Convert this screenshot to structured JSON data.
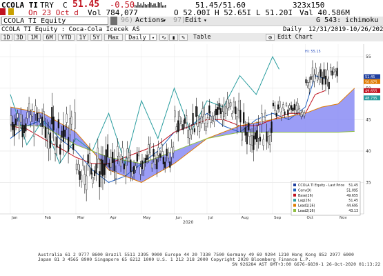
{
  "quote": {
    "ticker": "CCOLA TI",
    "currency": "TRY",
    "price_prefix": "C",
    "price": "51.45",
    "change": "-0.50",
    "bid_ask": "51.45/51.60",
    "size": "323x150",
    "date_label": "On 23 Oct d",
    "volume": "Vol 784,077",
    "open": "O 52.00I",
    "high": "H 52.65I",
    "low": "L 51.20I",
    "value": "Val 40.586M"
  },
  "command": {
    "security": "CCOLA TI Equity",
    "actions_num": "96)",
    "actions": "Actions",
    "edit_num": "97)",
    "edit": "Edit",
    "page": "G 543: ichimoku"
  },
  "title": {
    "name": "CCOLA TI Equity : Coca-Cola Icecek AS",
    "period": "Daily",
    "range": "12/31/2019-10/26/2020"
  },
  "toolbar": {
    "periods": [
      "1D",
      "3D",
      "1M",
      "6M",
      "YTD",
      "1Y",
      "5Y",
      "Max"
    ],
    "frequency": "Daily",
    "table": "Table",
    "edit_chart": "Edit Chart"
  },
  "chart_data": {
    "type": "line",
    "xlabel": "2020",
    "x_ticks": [
      "Jan",
      "Feb",
      "Mar",
      "Apr",
      "May",
      "Jun",
      "Jul",
      "Aug",
      "Sep",
      "Oct",
      "Nov"
    ],
    "y_ticks": [
      35,
      40,
      45,
      50,
      55
    ],
    "ylim": [
      30,
      57
    ],
    "y_label_side": "right",
    "grid": true,
    "annotation": "Hi: 55.15",
    "price_candles_monthly": [
      {
        "month": "Jan",
        "low": 40,
        "high": 50
      },
      {
        "month": "Feb",
        "low": 36,
        "high": 50
      },
      {
        "month": "Mar",
        "low": 31,
        "high": 44
      },
      {
        "month": "Apr",
        "low": 33,
        "high": 43
      },
      {
        "month": "May",
        "low": 35,
        "high": 43
      },
      {
        "month": "Jun",
        "low": 40,
        "high": 49
      },
      {
        "month": "Jul",
        "low": 42,
        "high": 51
      },
      {
        "month": "Aug",
        "low": 38,
        "high": 49
      },
      {
        "month": "Sep",
        "low": 44,
        "high": 49
      },
      {
        "month": "Oct",
        "low": 48,
        "high": 55.15
      }
    ],
    "series": [
      {
        "name": "Conv(9)",
        "x": [
          0,
          0.5,
          1,
          1.5,
          2,
          2.5,
          3,
          3.5,
          4,
          4.5,
          5,
          5.5,
          6,
          6.5,
          7,
          7.5,
          8,
          8.5,
          9,
          9.3,
          9.6
        ],
        "values": [
          42,
          44,
          45,
          42,
          40,
          37,
          35,
          36,
          38,
          40,
          43,
          44,
          46,
          44,
          43,
          45,
          46,
          45,
          47,
          52,
          51.5
        ]
      },
      {
        "name": "Base(26)",
        "x": [
          0,
          0.5,
          1,
          1.5,
          2,
          2.5,
          3,
          3.5,
          4,
          4.5,
          5,
          5.5,
          6,
          6.5,
          7,
          7.5,
          8,
          8.5,
          9,
          9.3,
          9.6
        ],
        "values": [
          44,
          43.5,
          42,
          40.5,
          39,
          38,
          38,
          39,
          40,
          41,
          43,
          44,
          45,
          45,
          44,
          44,
          45,
          46,
          46,
          49,
          49.6
        ]
      },
      {
        "name": "Lag(26)",
        "x": [
          0,
          0.5,
          1,
          1.5,
          2,
          2.5,
          3,
          3.5,
          4,
          4.5,
          5,
          5.5,
          6,
          6.5,
          7,
          7.5,
          8,
          8.2
        ],
        "values": [
          49,
          41,
          45,
          38,
          42,
          40,
          46,
          38,
          48,
          42,
          50,
          43,
          48,
          47,
          52,
          49,
          55,
          53
        ]
      },
      {
        "name": "Lead1(26)",
        "x": [
          0,
          1,
          2,
          3,
          4,
          5,
          6,
          7,
          8,
          9,
          9.5,
          10,
          10.5
        ],
        "values": [
          47,
          46,
          43,
          37,
          35,
          38,
          42,
          44,
          45,
          46,
          47,
          47.5,
          50
        ]
      },
      {
        "name": "Lead2(26)",
        "x": [
          0,
          1,
          2,
          3,
          4,
          5,
          6,
          7,
          8,
          9,
          9.5,
          10,
          10.5
        ],
        "values": [
          44,
          44,
          41,
          39,
          38,
          40,
          42,
          43,
          43,
          43,
          43,
          43,
          43.13
        ]
      }
    ],
    "legend": {
      "placement": "bottom-right",
      "entries": [
        {
          "label": "CCOLA TI Equity - Last Price",
          "value": "51.45",
          "color": "#1f3f9f"
        },
        {
          "label": "Conv(9)",
          "value": "51.095",
          "color": "#1f5fbf"
        },
        {
          "label": "Base(26)",
          "value": "49.655",
          "color": "#c1121f"
        },
        {
          "label": "Lag(26)",
          "value": "51.45",
          "color": "#2a9d9f"
        },
        {
          "label": "Lead1(26)",
          "value": "44.695",
          "color": "#e07b00"
        },
        {
          "label": "Lead2(26)",
          "value": "43.13",
          "color": "#8fbf3f"
        }
      ]
    },
    "right_labels": [
      {
        "value": "51.45",
        "color": "#1f3f9f"
      },
      {
        "value": "50.875",
        "color": "#e07b00"
      },
      {
        "value": "49.655",
        "color": "#c1121f"
      },
      {
        "value": "48.735",
        "color": "#2a9d9f"
      }
    ],
    "colors": {
      "cloud": "#8a8cf5",
      "price": "#111111",
      "conv": "#1f5fbf",
      "base": "#c1121f",
      "lag": "#2a9d9f",
      "lead1": "#e07b00",
      "lead2": "#8fbf3f"
    }
  },
  "footer": {
    "line1": "Australia 61 2 9777 8600 Brazil 5511 2395 9000 Europe 44 20 7330 7500 Germany 49 69 9204 1210 Hong Kong 852 2977 6000",
    "line2": "Japan 81 3 4565 8900      Singapore 65 6212 1000      U.S. 1 212 318 2000      Copyright 2020 Bloomberg Finance L.P.",
    "line3": "SN 926284 AST  GMT+3:00 G676-6839-1 26-Oct-2020 01:13:22"
  }
}
